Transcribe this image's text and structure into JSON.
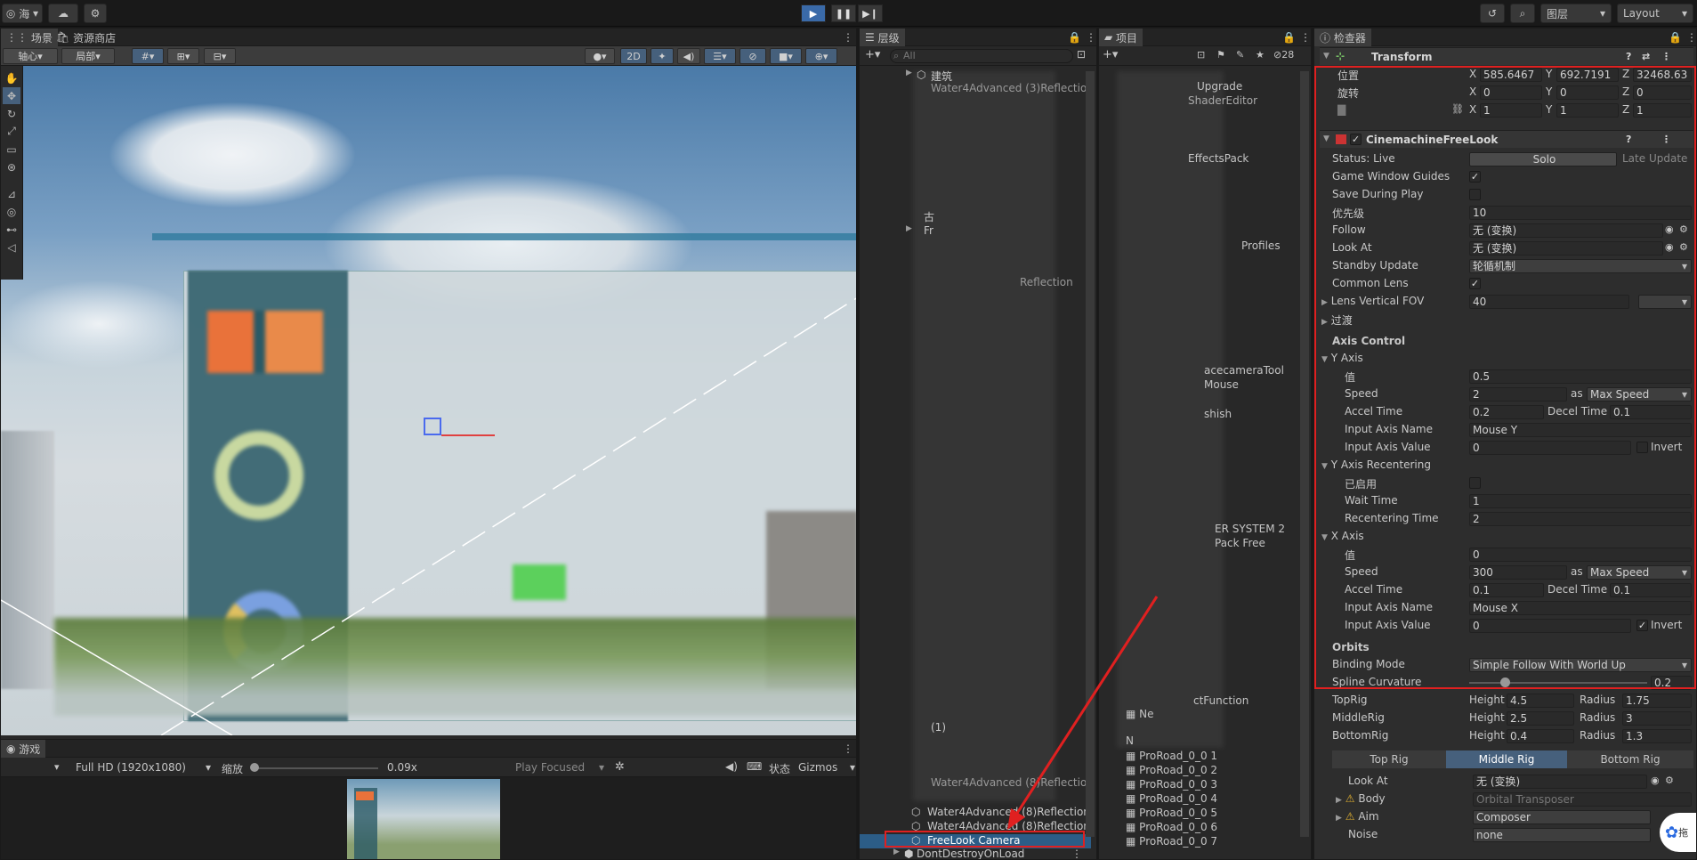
{
  "topbar": {
    "account": "海",
    "layers": "图层",
    "layout": "Layout"
  },
  "scene": {
    "tab_scene": "场景",
    "tab_store": "资源商店",
    "pivot": "轴心",
    "local": "局部",
    "mode2d": "2D"
  },
  "game": {
    "tab": "游戏",
    "resolution": "Full HD (1920x1080)",
    "scale_label": "缩放",
    "scale_value": "0.09x",
    "play_focused": "Play Focused",
    "stats": "状态",
    "gizmos": "Gizmos"
  },
  "hierarchy": {
    "tab": "层级",
    "search_placeholder": "All",
    "items": [
      "建筑",
      "Water4Advanced (3)Reflection",
      "Water4Advanced (8)Reflection",
      "Water4Advanced (8)Reflection",
      "FreeLook Camera",
      "DontDestroyOnLoad"
    ],
    "partial": [
      "古",
      "Fr",
      "(1)",
      "Reflection"
    ]
  },
  "project": {
    "tab": "项目",
    "count": "28",
    "items": [
      "ProRoad_0_0 1",
      "ProRoad_0_0 2",
      "ProRoad_0_0 3",
      "ProRoad_0_0 4",
      "ProRoad_0_0 5",
      "ProRoad_0_0 6",
      "ProRoad_0_0 7"
    ],
    "partial": [
      "Upgrade",
      "ShaderEditor",
      "EffectsPack",
      "Profiles",
      "acecameraTool",
      "Mouse",
      "shish",
      "ER SYSTEM 2",
      "Pack Free",
      "ctFunction",
      "N",
      "Ne"
    ]
  },
  "inspector": {
    "tab": "检查器",
    "transform": {
      "title": "Transform",
      "position_label": "位置",
      "rotation_label": "旋转",
      "pos": [
        "585.6467",
        "692.7191",
        "32468.63"
      ],
      "rot": [
        "0",
        "0",
        "0"
      ],
      "scale": [
        "1",
        "1",
        "1"
      ]
    },
    "cm": {
      "title": "CinemachineFreeLook",
      "status": "Status: Live",
      "solo": "Solo",
      "late_update": "Late Update",
      "game_window_guides": "Game Window Guides",
      "save_during_play": "Save During Play",
      "priority_label": "优先级",
      "priority": "10",
      "follow_label": "Follow",
      "follow": "无 (变换)",
      "look_at_label": "Look At",
      "look_at": "无 (变换)",
      "standby_label": "Standby Update",
      "standby": "轮循机制",
      "common_lens": "Common Lens",
      "lens_fov_label": "Lens Vertical FOV",
      "lens_fov": "40",
      "transitions": "过渡",
      "axis_control": "Axis Control",
      "y_axis": {
        "title": "Y Axis",
        "value_label": "值",
        "value": "0.5",
        "speed_label": "Speed",
        "speed": "2",
        "as": "as",
        "speed_mode": "Max Speed",
        "accel_label": "Accel Time",
        "accel": "0.2",
        "decel_label": "Decel Time",
        "decel": "0.1",
        "input_name_label": "Input Axis Name",
        "input_name": "Mouse Y",
        "input_value_label": "Input Axis Value",
        "input_value": "0",
        "invert": "Invert"
      },
      "y_recenter": {
        "title": "Y Axis Recentering",
        "enabled_label": "已启用",
        "wait_label": "Wait Time",
        "wait": "1",
        "recenter_label": "Recentering Time",
        "recenter": "2"
      },
      "x_axis": {
        "title": "X Axis",
        "value_label": "值",
        "value": "0",
        "speed_label": "Speed",
        "speed": "300",
        "as": "as",
        "speed_mode": "Max Speed",
        "accel_label": "Accel Time",
        "accel": "0.1",
        "decel_label": "Decel Time",
        "decel": "0.1",
        "input_name_label": "Input Axis Name",
        "input_name": "Mouse X",
        "input_value_label": "Input Axis Value",
        "input_value": "0",
        "invert": "Invert"
      },
      "orbits": "Orbits",
      "binding_label": "Binding Mode",
      "binding": "Simple Follow With World Up",
      "spline_label": "Spline Curvature",
      "spline": "0.2",
      "spline_fraction": 0.2,
      "height": "Height",
      "radius": "Radius",
      "rigs": [
        {
          "name": "TopRig",
          "height": "4.5",
          "radius": "1.75"
        },
        {
          "name": "MiddleRig",
          "height": "2.5",
          "radius": "3"
        },
        {
          "name": "BottomRig",
          "height": "0.4",
          "radius": "1.3"
        }
      ],
      "rig_tabs": [
        "Top Rig",
        "Middle Rig",
        "Bottom Rig"
      ],
      "rig_look_at_label": "Look At",
      "rig_look_at": "无 (变换)",
      "body_label": "Body",
      "body": "Orbital Transposer",
      "aim_label": "Aim",
      "aim": "Composer",
      "noise_label": "Noise",
      "noise": "none",
      "side_btn": "拖"
    }
  }
}
